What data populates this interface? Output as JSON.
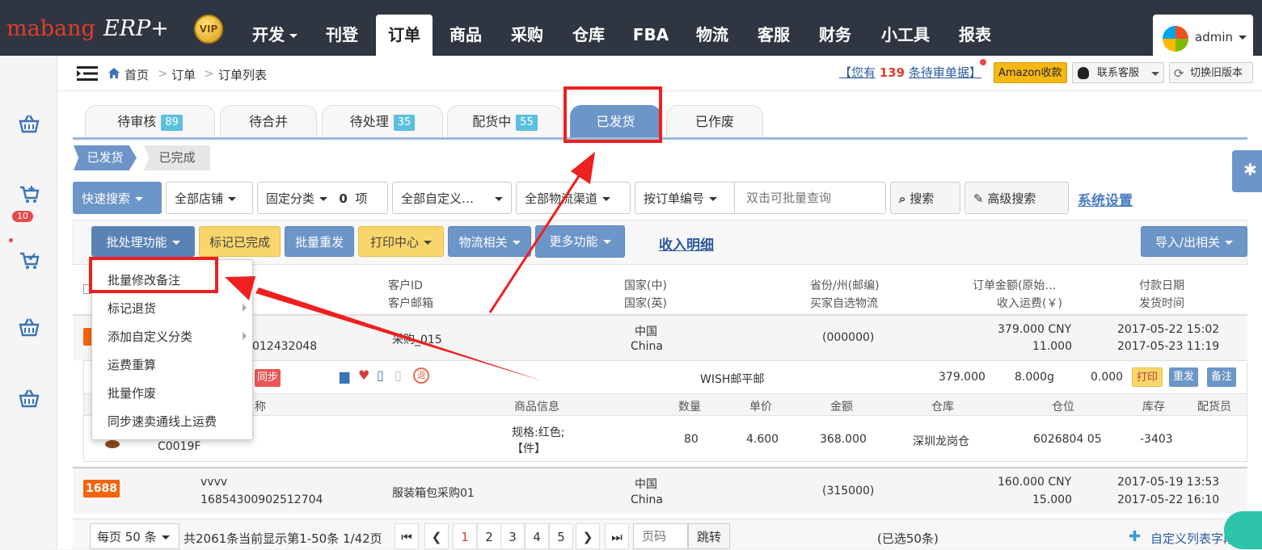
{
  "logo": {
    "brand": "mabang",
    "product": "ERP+",
    "badge": "VIP"
  },
  "nav": [
    "开发",
    "刊登",
    "订单",
    "商品",
    "采购",
    "仓库",
    "FBA",
    "物流",
    "客服",
    "财务",
    "小工具",
    "报表"
  ],
  "user": {
    "name": "admin"
  },
  "sidebar": {
    "cart_count": "10"
  },
  "breadcrumb": {
    "home": "首页",
    "sep": ">",
    "level1": "订单",
    "level2": "订单列表"
  },
  "notice": {
    "prefix": "【您有",
    "count": "139",
    "suffix": "条待审单据】"
  },
  "header_buttons": {
    "amazon": "Amazon收款",
    "service": "联系客服",
    "old_version": "切换旧版本"
  },
  "tabs": [
    {
      "label": "待审核",
      "count": "89"
    },
    {
      "label": "待合并",
      "count": ""
    },
    {
      "label": "待处理",
      "count": "35"
    },
    {
      "label": "配货中",
      "count": "55"
    },
    {
      "label": "已发货",
      "count": ""
    },
    {
      "label": "已作废",
      "count": ""
    }
  ],
  "subtabs": [
    "已发货",
    "已完成"
  ],
  "filters": {
    "quick_search": "快速搜索",
    "all_shops": "全部店铺",
    "fixed_category": "固定分类",
    "fixed_count": "0",
    "fixed_unit": "项",
    "all_custom": "全部自定义…",
    "all_channels": "全部物流渠道",
    "by_order_no": "按订单编号",
    "search_placeholder": "双击可批量查询",
    "search": "搜索",
    "advanced_search": "高级搜索",
    "settings": "系统设置"
  },
  "toolbar": {
    "batch": "批处理功能",
    "mark_done": "标记已完成",
    "batch_resend": "批量重发",
    "print_center": "打印中心",
    "logistics": "物流相关",
    "more": "更多功能",
    "income": "收入明细",
    "import_export": "导入/出相关"
  },
  "dropdown": [
    "批量修改备注",
    "标记退货",
    "添加自定义分类",
    "运费重算",
    "批量作废",
    "同步速卖通线上运费"
  ],
  "table_header": {
    "customer_id": "客户ID",
    "customer_email": "客户邮箱",
    "country_cn": "国家(中)",
    "country_en": "国家(英)",
    "province": "省份/州(邮编)",
    "buyer_shipping": "买家自选物流",
    "amount": "订单金额(原始…",
    "income_freight": "收入运费(￥)",
    "pay_date": "付款日期",
    "ship_time": "发货时间"
  },
  "orders": [
    {
      "customer_id": "采购_015",
      "customer_email": "012432048",
      "country_cn": "中国",
      "country_en": "China",
      "zip": "(000000)",
      "amount": "379.000 CNY",
      "freight": "11.000",
      "pay_date": "2017-05-22 15:02",
      "ship_date": "2017-05-23 11:19",
      "sync": "同步",
      "shipping": "WISH邮平邮",
      "val1": "379.000",
      "weight": "8.000g",
      "val3": "0.000",
      "actions": [
        "打印",
        "重发",
        "备注"
      ],
      "item_headers": [
        "称",
        "商品信息",
        "数量",
        "单价",
        "金额",
        "仓库",
        "仓位",
        "库存",
        "配货员"
      ],
      "item": {
        "sku": "C0019F",
        "spec": "规格:红色;",
        "unit": "【件】",
        "qty": "80",
        "price": "4.600",
        "total": "368.000",
        "warehouse": "深圳龙岗仓",
        "location": "6026804 05",
        "stock": "-3403"
      }
    },
    {
      "source": "1688",
      "customer_name": "vvvv",
      "customer_email": "16854300902512704",
      "customer_id": "服装箱包采购01",
      "country_cn": "中国",
      "country_en": "China",
      "zip": "(315000)",
      "amount": "160.000 CNY",
      "freight": "15.000",
      "pay_date": "2017-05-19 13:53",
      "ship_date": "2017-05-22 16:10"
    }
  ],
  "pager": {
    "per_page": "每页 50 条",
    "summary": "共2061条当前显示第1-50条 1/42页",
    "pages": [
      "1",
      "2",
      "3",
      "4",
      "5"
    ],
    "page_input_placeholder": "页码",
    "jump": "跳转",
    "selected": "(已选50条)",
    "custom_fields": "自定义列表字段"
  },
  "colors": {
    "accent": "#6c95c8",
    "yellow": "#f9d66b",
    "orange": "#f5640a",
    "red": "#ee2020",
    "topbar": "#2f3541"
  }
}
